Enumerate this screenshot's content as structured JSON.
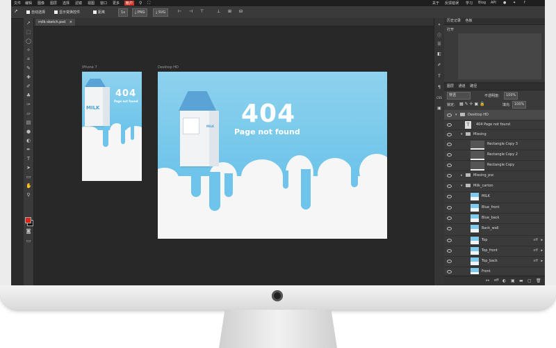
{
  "menu": {
    "items": [
      "文件",
      "编辑",
      "图像",
      "图层",
      "选择",
      "滤镜",
      "视图",
      "窗口",
      "更多"
    ],
    "account": "帐户",
    "right": [
      "关于",
      "反馈错误",
      "学习",
      "Blog",
      "API"
    ]
  },
  "options": {
    "auto_select": "自动选择",
    "show_transform": "显示变换控件",
    "distance": "距离",
    "zoom_value": "1x",
    "png": "PNG",
    "svg": "SVG"
  },
  "document_tab": {
    "label": "milk-sketch.psd",
    "close": "×"
  },
  "artboards": {
    "phone": {
      "label": "iPhone 7",
      "title": "404",
      "subtitle": "Page not found",
      "carton_text": "MILK"
    },
    "desktop": {
      "label": "Desktop HD",
      "title": "404",
      "subtitle": "Page not found",
      "carton_text": "MILK"
    }
  },
  "history_panel": {
    "tabs": [
      "历史记录",
      "色板"
    ],
    "first_item": "打开"
  },
  "layers_panel": {
    "tabs": [
      "图层",
      "通道",
      "路径"
    ],
    "blend_mode": "穿透",
    "opacity_label": "不透明度:",
    "opacity_value": "100%",
    "lock_label": "锁定:",
    "fill_label": "填充:",
    "fill_value": "100%",
    "layers": [
      {
        "name": "Desktop HD",
        "type": "artboard"
      },
      {
        "name": "404 Page not found",
        "type": "text"
      },
      {
        "name": "Missing",
        "type": "group-open"
      },
      {
        "name": "Rectangle Copy 3",
        "type": "shape"
      },
      {
        "name": "Rectangle Copy 2",
        "type": "shape"
      },
      {
        "name": "Rectangle Copy",
        "type": "shape"
      },
      {
        "name": "Missing_psc",
        "type": "group-closed"
      },
      {
        "name": "Milk_carton",
        "type": "group-open"
      },
      {
        "name": "MILK",
        "type": "image"
      },
      {
        "name": "Blue_front",
        "type": "image"
      },
      {
        "name": "Blue_back",
        "type": "image"
      },
      {
        "name": "Back_wall",
        "type": "image"
      },
      {
        "name": "Top",
        "type": "image-fx"
      },
      {
        "name": "Top_front",
        "type": "image-fx"
      },
      {
        "name": "Top_back",
        "type": "image-fx"
      },
      {
        "name": "Front",
        "type": "image"
      }
    ],
    "fx_label": "eff",
    "footer_label": "eff"
  },
  "colors": {
    "accent_red": "#d2352b",
    "sky_blue": "#6ec4ea",
    "foreground_swatch": "#d9281a",
    "background_swatch": "#111111"
  },
  "icons": {
    "toolbar": [
      "move-icon",
      "marquee-icon",
      "lasso-icon",
      "magic-wand-icon",
      "crop-icon",
      "eyedropper-icon",
      "healing-icon",
      "brush-icon",
      "clone-stamp-icon",
      "history-brush-icon",
      "eraser-icon",
      "gradient-icon",
      "blur-icon",
      "dodge-icon",
      "pen-icon",
      "text-icon",
      "path-select-icon",
      "shape-icon",
      "hand-icon",
      "zoom-icon"
    ]
  }
}
